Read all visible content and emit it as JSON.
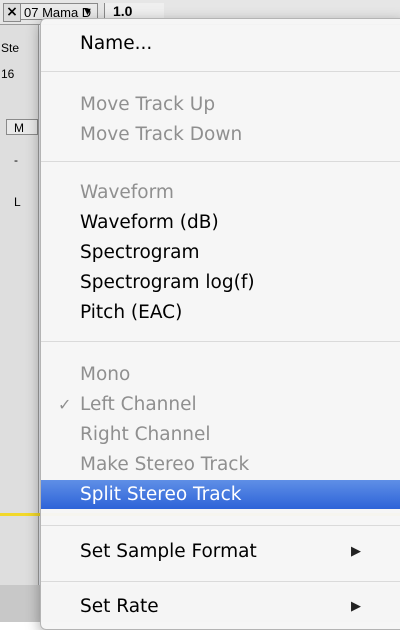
{
  "track": {
    "close_glyph": "×",
    "name": "07 Mama D",
    "dropdown_glyph": "▼",
    "ruler_value": "1.0",
    "info_line1": "Ste",
    "info_line2": "16",
    "side_button": "M",
    "side_mark1": "-",
    "side_mark2": "L"
  },
  "menu": {
    "name": "Name...",
    "move_up": "Move Track Up",
    "move_down": "Move Track Down",
    "waveform": "Waveform",
    "waveform_db": "Waveform (dB)",
    "spectrogram": "Spectrogram",
    "spectrogram_log": "Spectrogram log(f)",
    "pitch": "Pitch (EAC)",
    "mono": "Mono",
    "left_channel": "Left Channel",
    "left_channel_check": "✓",
    "right_channel": "Right Channel",
    "make_stereo": "Make Stereo Track",
    "split_stereo": "Split Stereo Track",
    "set_sample_format": "Set Sample Format",
    "set_rate": "Set Rate",
    "submenu_arrow": "▶"
  },
  "colors": {
    "highlight": "#3b70e0",
    "disabled_text": "#8f8f8f",
    "accent_line": "#f2d82a"
  }
}
